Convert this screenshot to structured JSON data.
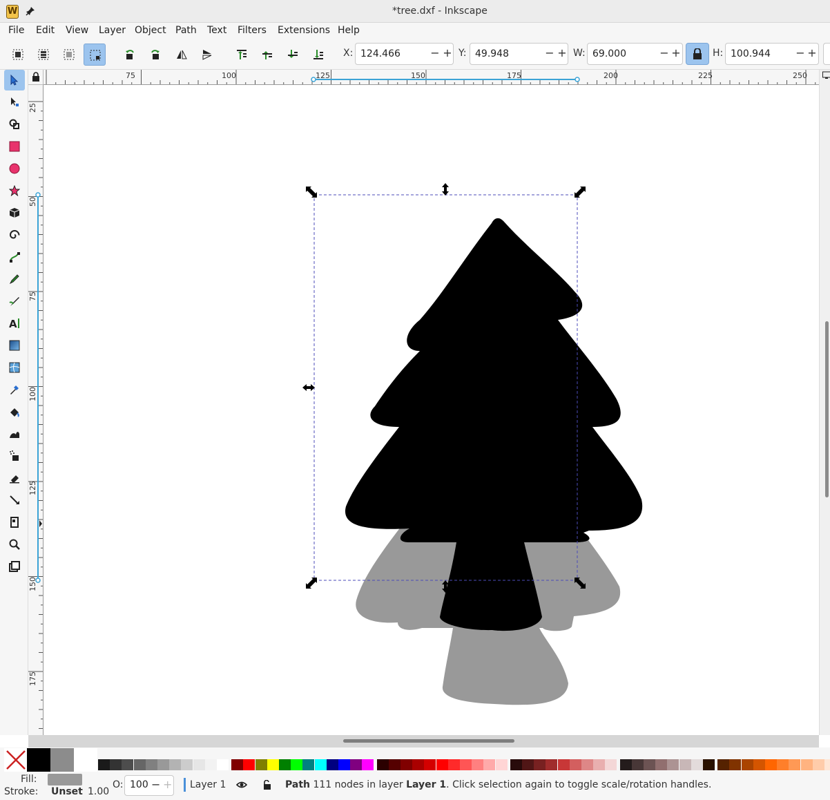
{
  "window": {
    "title": "*tree.dxf - Inkscape"
  },
  "menu": [
    "File",
    "Edit",
    "View",
    "Layer",
    "Object",
    "Path",
    "Text",
    "Filters",
    "Extensions",
    "Help"
  ],
  "toolbar": {
    "x_label": "X:",
    "x_value": "124.466",
    "y_label": "Y:",
    "y_value": "49.948",
    "w_label": "W:",
    "w_value": "69.000",
    "h_label": "H:",
    "h_value": "100.944"
  },
  "rulers": {
    "horizontal": [
      "75",
      "100",
      "125",
      "150",
      "175",
      "200",
      "225",
      "250"
    ],
    "vertical": [
      "25",
      "50",
      "75",
      "100",
      "125",
      "150",
      "175"
    ]
  },
  "canvas": {
    "tree_colors": {
      "shadow": "#999999",
      "front": "#000000"
    },
    "selection_color": "#4b4bb8"
  },
  "palette": {
    "selected_fill": "#000000",
    "selected_gray": "#8c8c8c",
    "colors": [
      "#1a1a1a",
      "#333333",
      "#4d4d4d",
      "#666666",
      "#808080",
      "#999999",
      "#b3b3b3",
      "#cccccc",
      "#e6e6e6",
      "#f2f2f2",
      "#ffffff",
      "#800000",
      "#ff0000",
      "#808000",
      "#ffff00",
      "#008000",
      "#00ff00",
      "#008080",
      "#00ffff",
      "#000080",
      "#0000ff",
      "#800080",
      "#ff00ff",
      "#2b0000",
      "#550000",
      "#800000",
      "#aa0000",
      "#d40000",
      "#ff0000",
      "#ff2a2a",
      "#ff5555",
      "#ff8080",
      "#ffaaaa",
      "#ffd5d5",
      "#280b0b",
      "#501616",
      "#782121",
      "#a02c2c",
      "#c83737",
      "#d35f5f",
      "#de8787",
      "#e9afaf",
      "#f4d7d7",
      "#241c1c",
      "#483737",
      "#6c5353",
      "#916f6f",
      "#ac9393",
      "#c8b7b7",
      "#e3dbdb",
      "#2b1100",
      "#552200",
      "#803300",
      "#aa4400",
      "#d45500",
      "#ff6600",
      "#ff7f2a",
      "#ff9955",
      "#ffb380",
      "#ffccaa",
      "#ffe6d5",
      "#241f1c"
    ]
  },
  "status": {
    "fill_label": "Fill:",
    "stroke_label": "Stroke:",
    "stroke_value": "Unset",
    "stroke_width": "1.00",
    "opacity_label": "O:",
    "opacity_value": "100",
    "layer_name": "Layer 1",
    "message_prefix": "Path",
    "message_middle": " 111 nodes in layer ",
    "message_layer": "Layer 1",
    "message_suffix": ". Click selection again to toggle scale/rotation handles."
  }
}
